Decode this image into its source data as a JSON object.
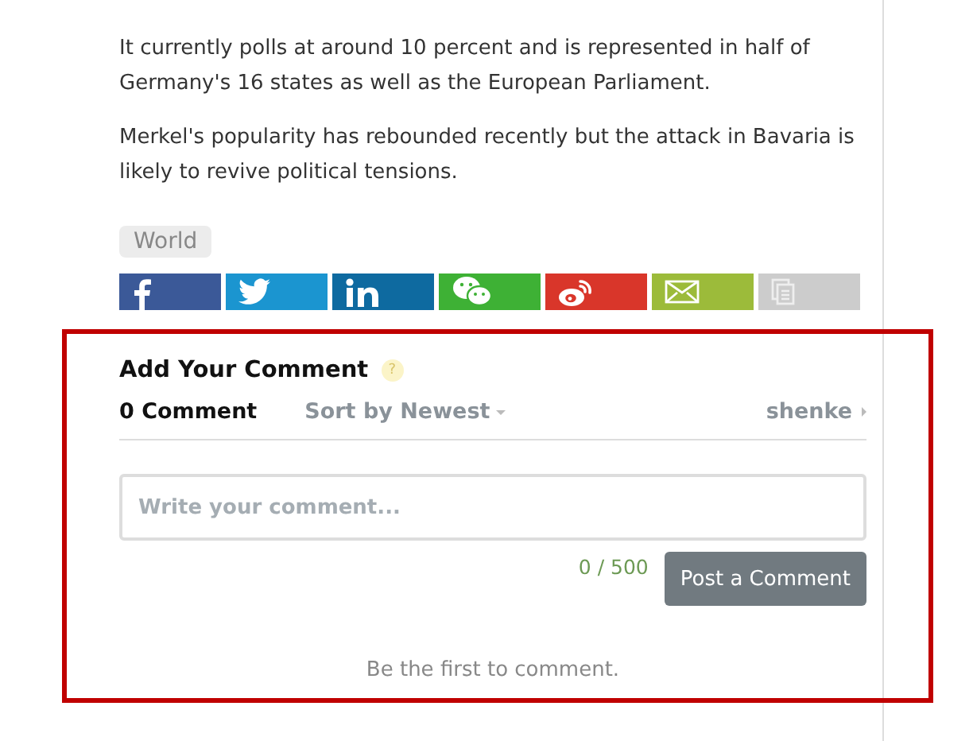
{
  "article": {
    "paragraphs": [
      "It currently polls at around 10 percent and is represented in half of Germany's 16 states as well as the European Parliament.",
      "Merkel's popularity has rebounded recently but the attack in Bavaria is likely to revive political tensions."
    ],
    "tags": [
      "World"
    ]
  },
  "share_buttons": [
    {
      "kind": "facebook",
      "color": "#3b5998"
    },
    {
      "kind": "twitter",
      "color": "#1b95d0"
    },
    {
      "kind": "linkedin",
      "color": "#0e6aa0"
    },
    {
      "kind": "wechat",
      "color": "#3eb135"
    },
    {
      "kind": "weibo",
      "color": "#d9362a"
    },
    {
      "kind": "email",
      "color": "#9cbb3a"
    },
    {
      "kind": "copy",
      "color": "#cccccc"
    }
  ],
  "comments": {
    "title": "Add Your Comment",
    "help": "?",
    "count": "0 Comment",
    "sort": "Sort by Newest",
    "user": "shenke",
    "placeholder": "Write your comment...",
    "counter": "0 / 500",
    "submit": "Post a Comment",
    "empty": "Be the first to comment."
  }
}
